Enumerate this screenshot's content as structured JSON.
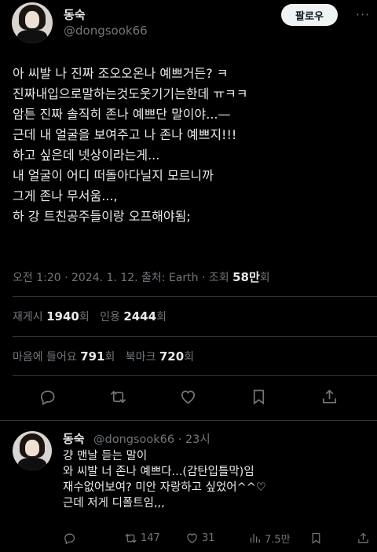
{
  "tweet": {
    "author_name": "동숙",
    "author_handle": "@dongsook66",
    "follow_label": "팔로우",
    "more_label": "···",
    "lines": [
      "아 씨발 나 진짜 조오오온나 예쁘거든? ㅋ",
      "진짜내입으로말하는것도웃기기는한데 ㅠㅋㅋ",
      "암튼 진짜 솔직히 존나 예쁘단 말이야...—",
      "근데 내 얼굴을 보여주고 나 존나 예쁘지!!!",
      "하고 싶은데 넷상이라는게...",
      "내 얼굴이 어디 떠돌아다닐지 모르니까",
      "그게 존나 무서움...,",
      "하 강 트친공주들이랑 오프해야됨;"
    ],
    "meta_prefix": "오전 1:20 · 2024. 1. 12. 출처: Earth · 조회 ",
    "views_count": "58만",
    "views_suffix": "회",
    "retweets_label": "재게시 ",
    "retweets_count": "1940",
    "retweets_suffix": "회",
    "quotes_label": "인용 ",
    "quotes_count": "2444",
    "quotes_suffix": "회",
    "likes_label": "마음에 들어요 ",
    "likes_count": "791",
    "likes_suffix": "회",
    "bookmarks_label": "북마크 ",
    "bookmarks_count": "720",
    "bookmarks_suffix": "회"
  },
  "reply": {
    "author_name": "동숙",
    "handle_time": "@dongsook66 · 23시",
    "lines": [
      "걍 맨날 듣는 말이",
      "와 씨발 너 존나 예쁘다...(감탄입틀막)임",
      "재수없어보여? 미안 자랑하고 싶었어^^♡",
      "근데 저게 디폴트임,,,"
    ],
    "retweets": "147",
    "likes": "31",
    "views": "7.5만"
  },
  "colors": {
    "background": "#000000",
    "text": "#e7e9ea",
    "muted": "#71767b",
    "divider": "#2f3336",
    "follow_bg": "#eff3f4"
  },
  "icons": [
    "reply-icon",
    "retweet-icon",
    "like-icon",
    "bookmark-icon",
    "share-icon",
    "views-icon"
  ]
}
